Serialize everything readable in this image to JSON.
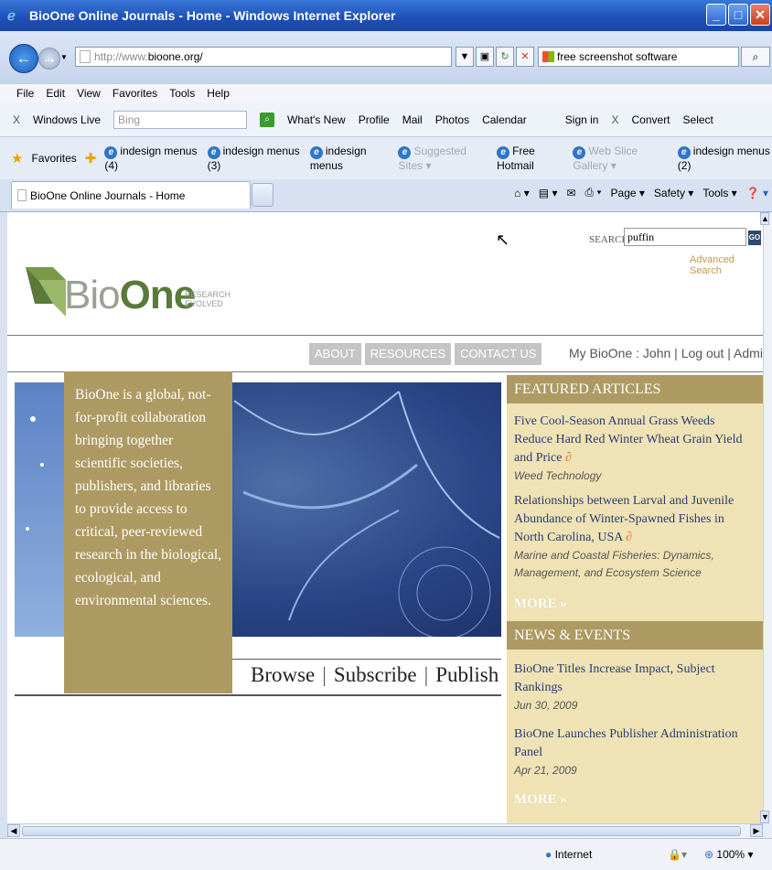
{
  "window": {
    "title": "BioOne Online Journals - Home - Windows Internet Explorer"
  },
  "address": {
    "url_prefix": "http://www.",
    "url_domain": "bioone.org/",
    "search_value": "free screenshot software"
  },
  "menu": [
    "File",
    "Edit",
    "View",
    "Favorites",
    "Tools",
    "Help"
  ],
  "live_toolbar": {
    "brand": "Windows Live",
    "search_placeholder": "Bing",
    "items": [
      "What's New",
      "Profile",
      "Mail",
      "Photos",
      "Calendar"
    ],
    "sign_in": "Sign in",
    "convert": "Convert",
    "select": "Select"
  },
  "favorites": {
    "label": "Favorites",
    "items": [
      "indesign menus (4)",
      "indesign menus (3)",
      "indesign menus"
    ],
    "suggested": "Suggested Sites",
    "hotmail": "Free Hotmail",
    "webslice": "Web Slice Gallery",
    "last": "indesign menus (2)"
  },
  "tab": {
    "title": "BioOne Online Journals - Home"
  },
  "commands": [
    "Page",
    "Safety",
    "Tools"
  ],
  "page": {
    "search_label": "SEARCH",
    "search_value": "puffin",
    "go": "GO",
    "advanced": "Advanced Search",
    "logo_bio": "Bio",
    "logo_one": "One",
    "logo_tag1": "RESEARCH",
    "logo_tag2": "EVOLVED",
    "nav": [
      "ABOUT",
      "RESOURCES",
      "CONTACT US"
    ],
    "user_links": "My BioOne : John | Log out | Admin | Help",
    "hero_text": "BioOne is a global, not-for-profit collaboration bringing together scientific societies, publishers, and libraries to provide access to critical, peer-reviewed research in the biological, ecological, and environmental sciences.",
    "links": [
      "Browse",
      "Subscribe",
      "Publish"
    ],
    "featured_head": "FEATURED ARTICLES",
    "articles": [
      {
        "title": "Five Cool-Season Annual Grass Weeds Reduce Hard Red Winter Wheat Grain Yield and Price",
        "journal": "Weed Technology"
      },
      {
        "title": "Relationships between Larval and Juvenile Abundance of Winter-Spawned Fishes in North Carolina, USA",
        "journal": "Marine and Coastal Fisheries: Dynamics, Management, and Ecosystem Science"
      }
    ],
    "more": "MORE »",
    "news_head": "NEWS & EVENTS",
    "news": [
      {
        "title": "BioOne Titles Increase Impact, Subject Rankings",
        "date": "Jun 30, 2009"
      },
      {
        "title": "BioOne Launches Publisher Administration Panel",
        "date": "Apr 21, 2009"
      }
    ]
  },
  "status": {
    "zone": "Internet",
    "zoom": "100%"
  }
}
